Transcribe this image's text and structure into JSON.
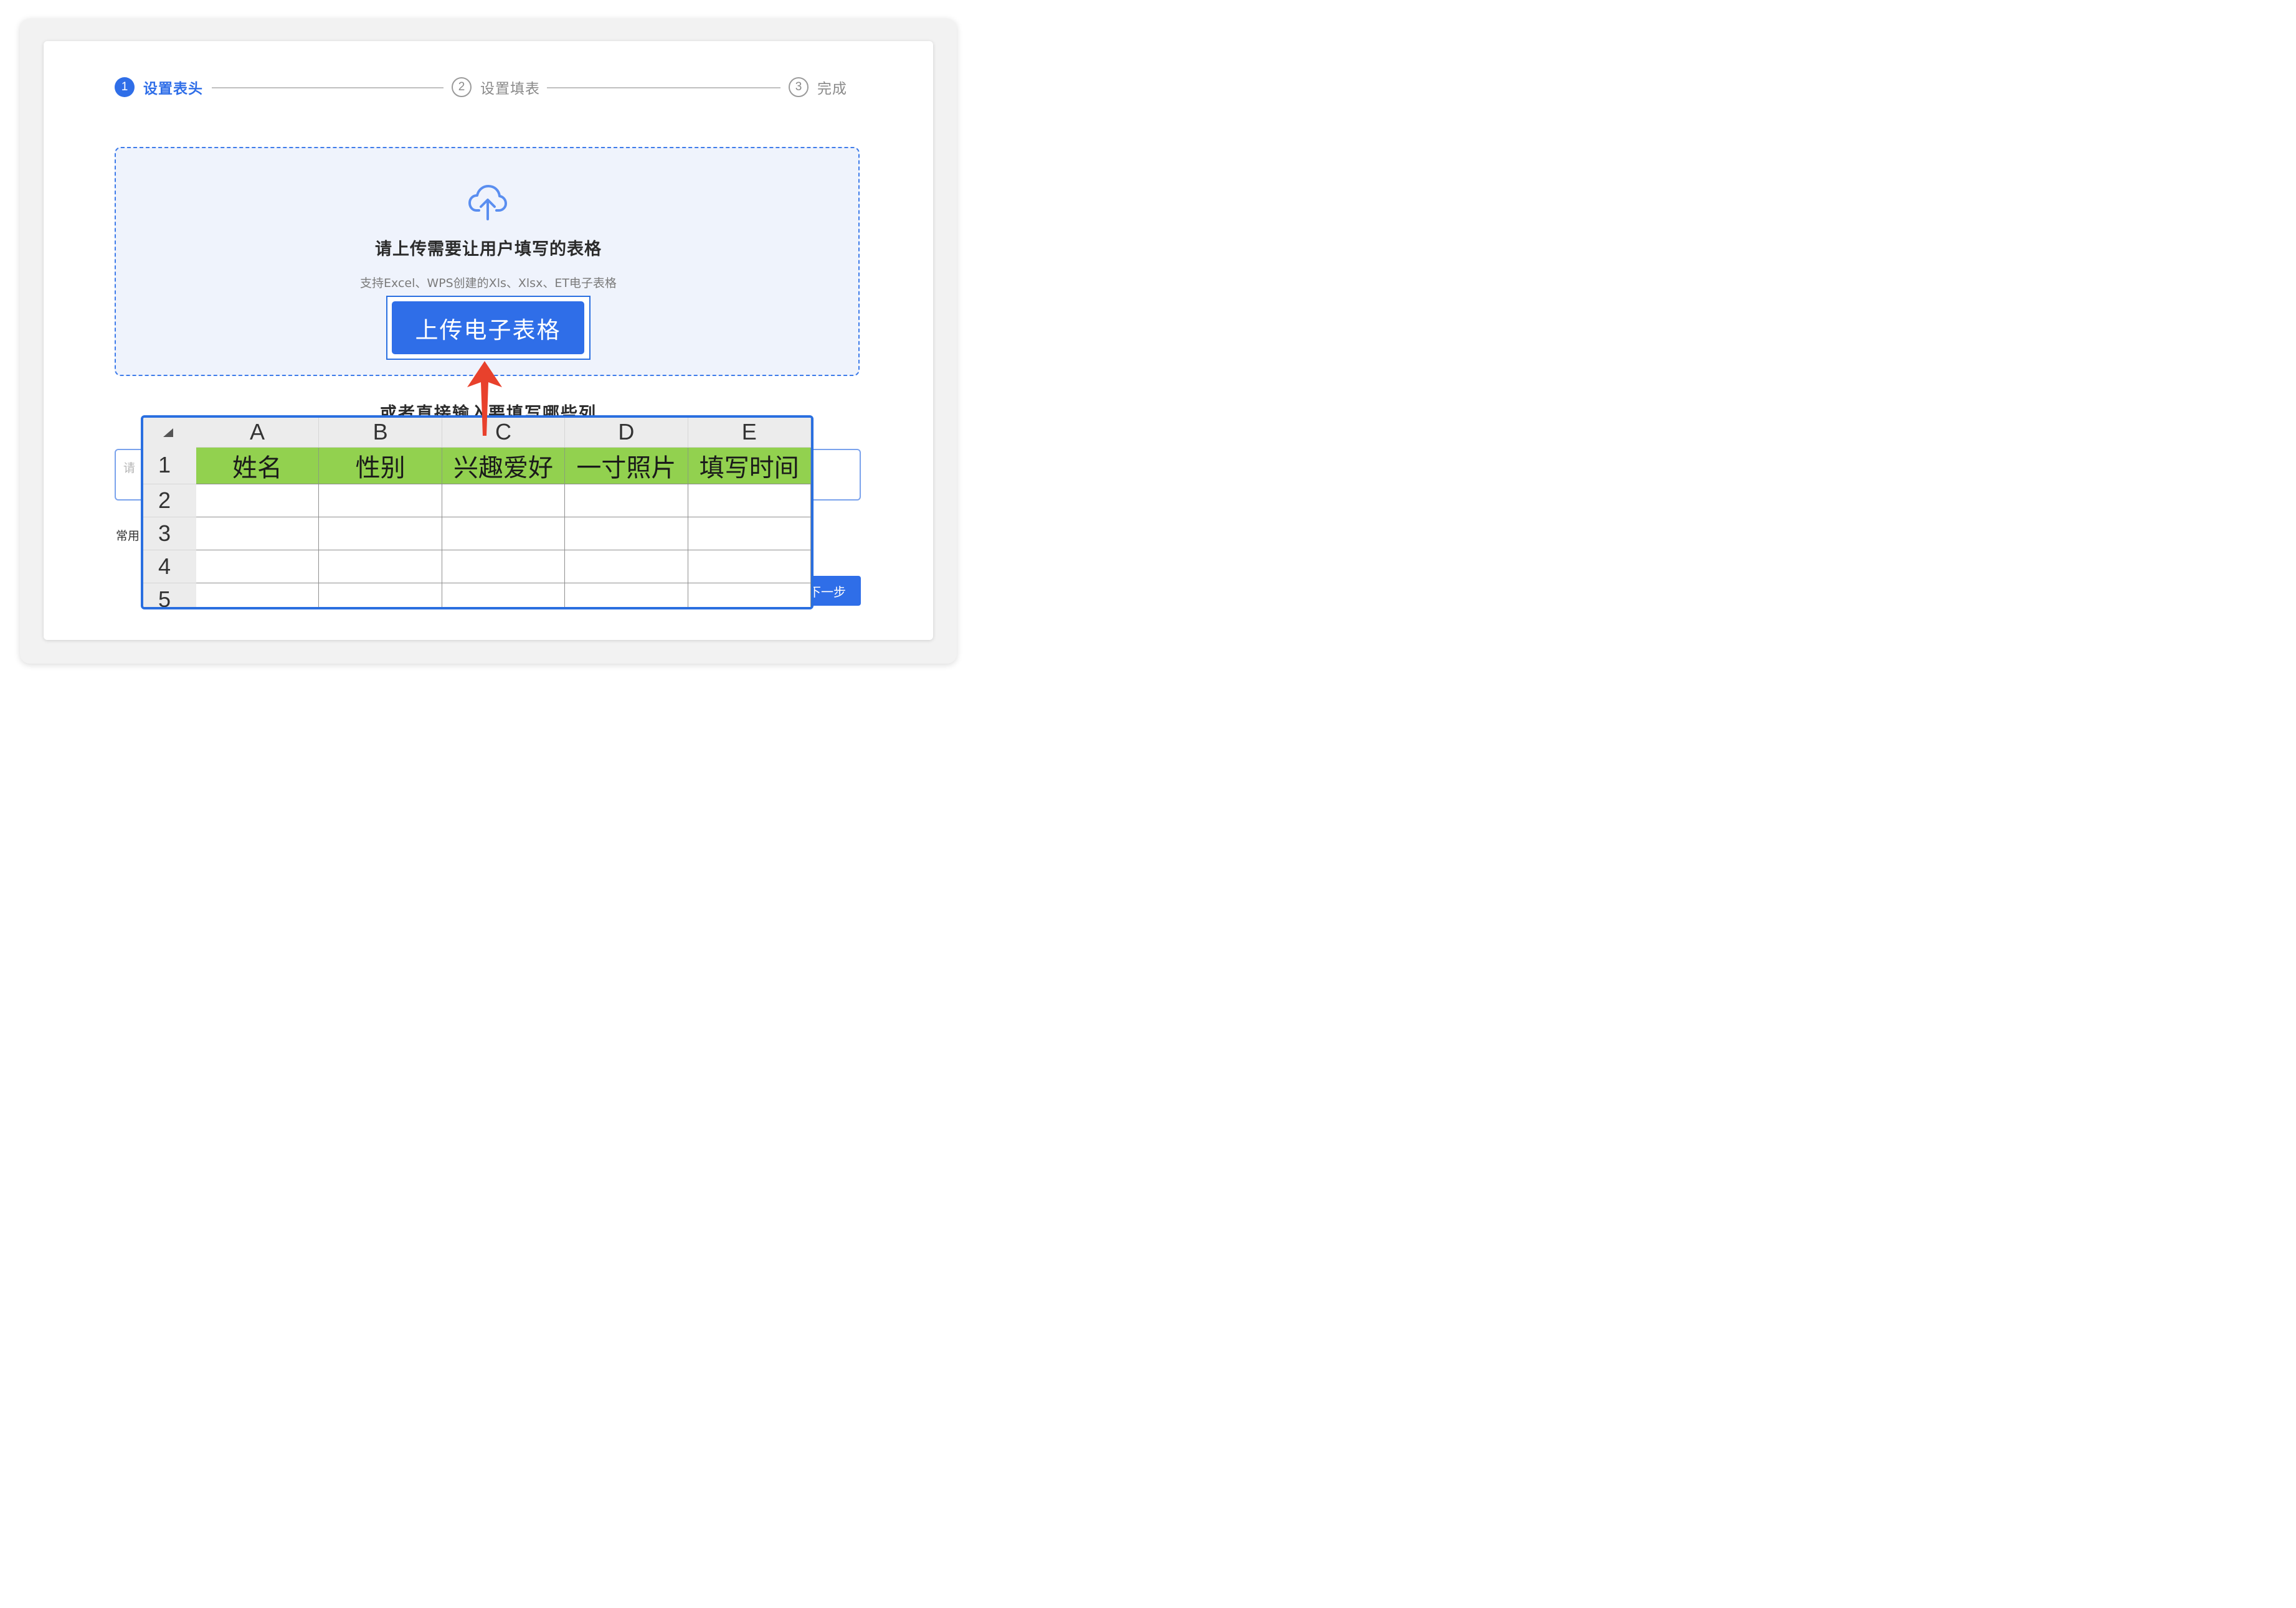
{
  "stepper": {
    "steps": [
      {
        "number": "1",
        "label": "设置表头",
        "state": "active"
      },
      {
        "number": "2",
        "label": "设置填表",
        "state": "idle"
      },
      {
        "number": "3",
        "label": "完成",
        "state": "idle"
      }
    ]
  },
  "upload": {
    "icon": "cloud-upload-icon",
    "title": "请上传需要让用户填写的表格",
    "hint": "支持Excel、WPS创建的Xls、Xlsx、ET电子表格",
    "button_label": "上传电子表格"
  },
  "manual": {
    "title": "或者直接输入要填写哪些列",
    "input_placeholder": "请",
    "common_label": "常用",
    "next_button": "下一步"
  },
  "spreadsheet": {
    "columns": [
      "A",
      "B",
      "C",
      "D",
      "E"
    ],
    "rows": [
      "1",
      "2",
      "3",
      "4",
      "5"
    ],
    "header_cells": [
      "姓名",
      "性别",
      "兴趣爱好",
      "一寸照片",
      "填写时间"
    ],
    "header_fill": "#92d14f"
  },
  "colors": {
    "accent": "#2f6ee8",
    "annotation_arrow": "#e8412c"
  }
}
